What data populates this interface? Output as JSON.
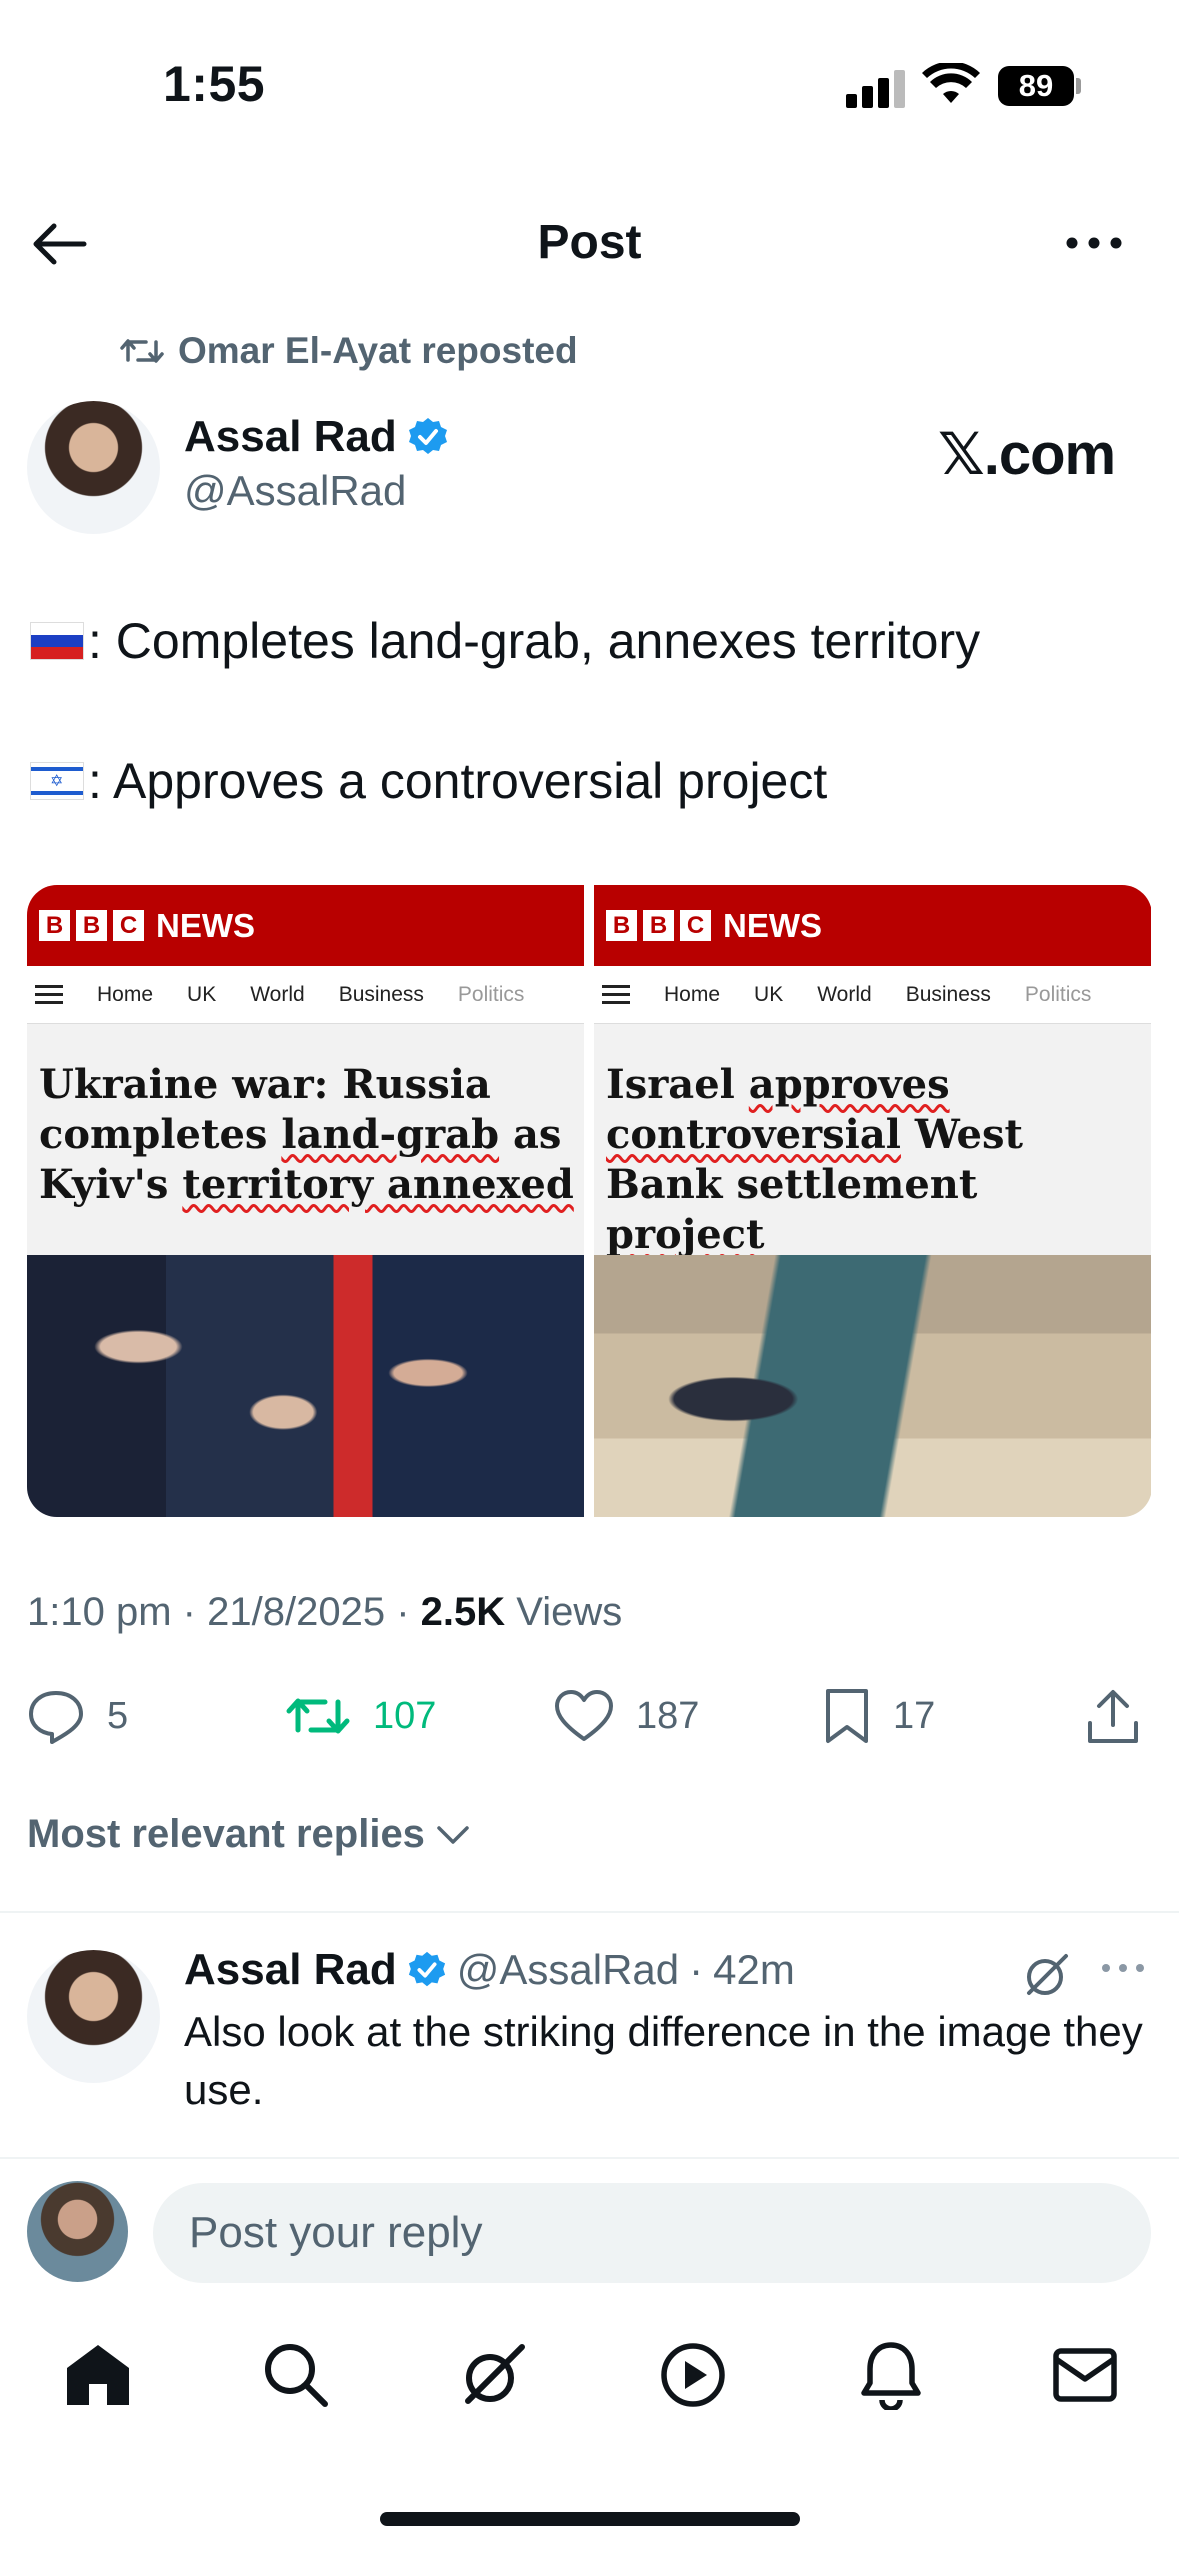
{
  "status_bar": {
    "time": "1:55",
    "battery": "89"
  },
  "header": {
    "title": "Post"
  },
  "repost": {
    "text": "Omar El-Ayat reposted"
  },
  "author": {
    "name": "Assal Rad",
    "handle": "@AssalRad",
    "watermark": "𝕏.com"
  },
  "tweet": {
    "lines": [
      {
        "flag": "russia-flag",
        "text": ": Completes land-grab, annexes territory"
      },
      {
        "flag": "israel-flag",
        "text": ": Approves a controversial project"
      }
    ]
  },
  "media": {
    "brand": "NEWS",
    "bbc_letters": [
      "B",
      "B",
      "C"
    ],
    "nav": [
      "Home",
      "UK",
      "World",
      "Business",
      "Politics"
    ],
    "left": {
      "headline_parts": [
        "Ukraine war: Russia completes ",
        "land-grab",
        " as Kyiv's ",
        "territory annexed"
      ]
    },
    "right": {
      "headline_parts": [
        "Israel ",
        "approves",
        " ",
        "controversial",
        " West Bank settlement ",
        "project"
      ]
    }
  },
  "meta": {
    "time": "1:10 pm",
    "date": "21/8/2025",
    "views_count": "2.5K",
    "views_label": "Views",
    "separator": "·"
  },
  "actions": {
    "replies": "5",
    "reposts": "107",
    "likes": "187",
    "bookmarks": "17"
  },
  "replies_sort": {
    "label": "Most relevant replies"
  },
  "reply": {
    "name": "Assal Rad",
    "handle": "@AssalRad",
    "time": "42m",
    "text": "Also look at the striking difference in the image they use."
  },
  "composer": {
    "placeholder": "Post your reply"
  },
  "colors": {
    "accent_blue": "#1d9bf0",
    "repost_green": "#00ba7c",
    "bbc_red": "#b80000",
    "secondary_text": "#536471"
  }
}
